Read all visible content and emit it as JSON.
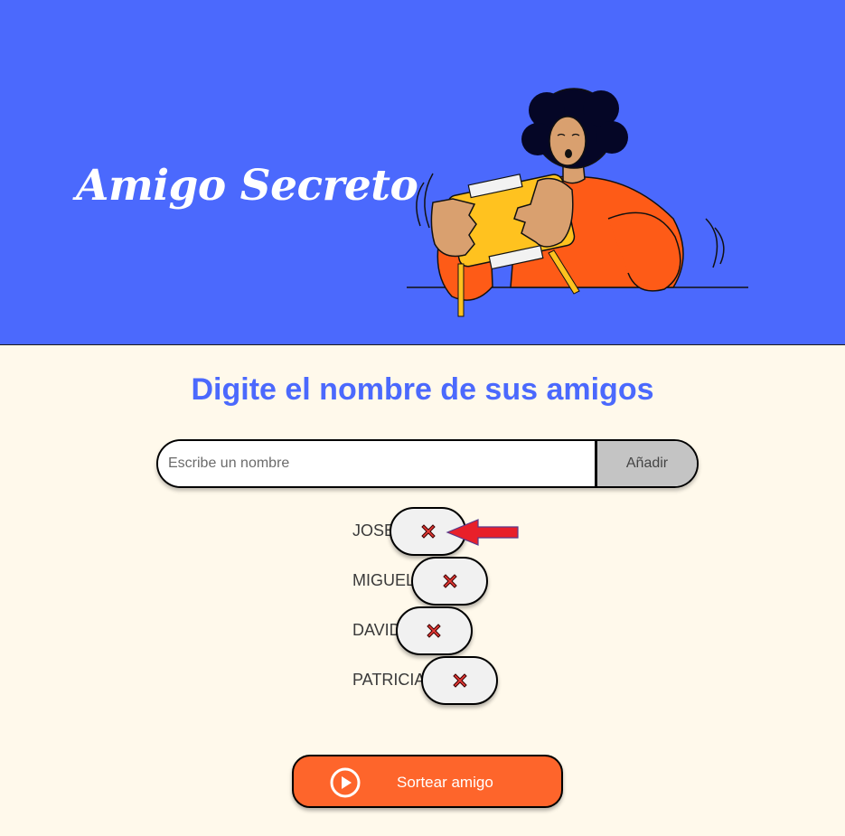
{
  "header": {
    "title": "Amigo Secreto"
  },
  "main": {
    "subtitle": "Digite el nombre de sus amigos",
    "input": {
      "value": "",
      "placeholder": "Escribe un nombre"
    },
    "add_label": "Añadir",
    "friends": [
      "JOSE",
      "MIGUEL",
      "DAVID",
      "PATRICIA"
    ],
    "draw_label": "Sortear amigo"
  },
  "colors": {
    "header_bg": "#4b69fd",
    "page_bg": "#fff9eb",
    "accent": "#fe652b",
    "subtitle": "#4b69fd",
    "remove_icon": "#e53935",
    "annotation_arrow": "#e8202a"
  },
  "icons": {
    "remove": "close-x-icon",
    "draw": "play-circle-icon",
    "annotation": "arrow-left-icon"
  }
}
